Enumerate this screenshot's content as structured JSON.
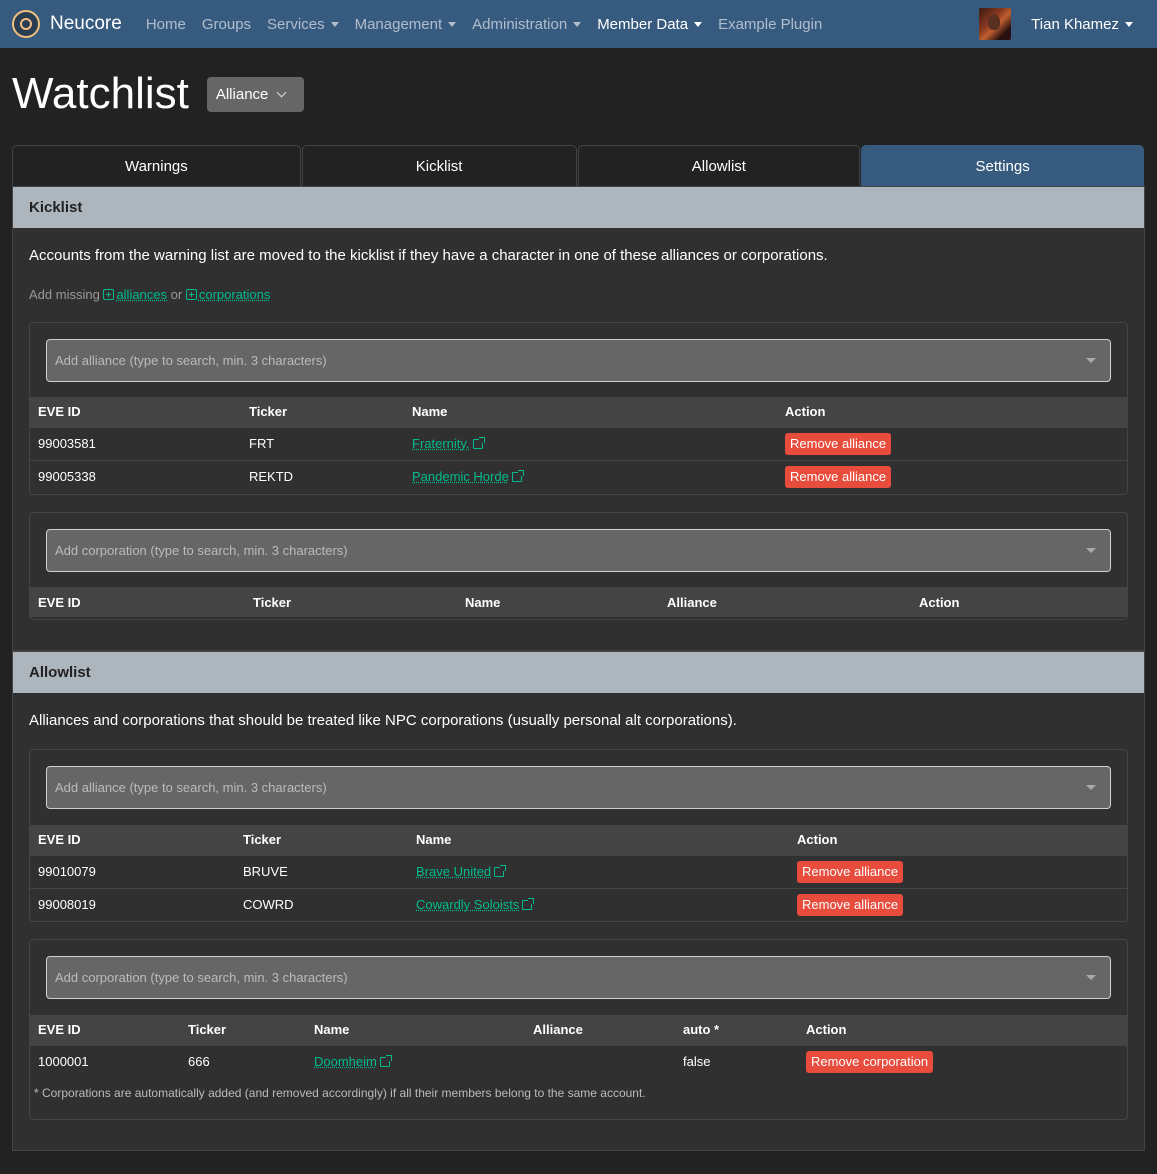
{
  "nav": {
    "brand": "Neucore",
    "items": [
      "Home",
      "Groups",
      "Services",
      "Management",
      "Administration",
      "Member Data",
      "Example Plugin"
    ],
    "user": "Tian Khamez"
  },
  "header": {
    "title": "Watchlist",
    "select_value": "Alliance"
  },
  "tabs": [
    "Warnings",
    "Kicklist",
    "Allowlist",
    "Settings"
  ],
  "kicklist": {
    "title": "Kicklist",
    "description": "Accounts from the warning list are moved to the kicklist if they have a character in one of these alliances or corporations.",
    "add_missing": "Add missing",
    "alliances_link": "alliances",
    "or": "or",
    "corporations_link": "corporations",
    "alliance_placeholder": "Add alliance (type to search, min. 3 characters)",
    "alliance_headers": [
      "EVE ID",
      "Ticker",
      "Name",
      "Action"
    ],
    "alliances": [
      {
        "id": "99003581",
        "ticker": "FRT",
        "name": "Fraternity.",
        "action": "Remove alliance"
      },
      {
        "id": "99005338",
        "ticker": "REKTD",
        "name": "Pandemic Horde",
        "action": "Remove alliance"
      }
    ],
    "corporation_placeholder": "Add corporation (type to search, min. 3 characters)",
    "corporation_headers": [
      "EVE ID",
      "Ticker",
      "Name",
      "Alliance",
      "Action"
    ]
  },
  "allowlist": {
    "title": "Allowlist",
    "description": "Alliances and corporations that should be treated like NPC corporations (usually personal alt corporations).",
    "alliance_placeholder": "Add alliance (type to search, min. 3 characters)",
    "alliance_headers": [
      "EVE ID",
      "Ticker",
      "Name",
      "Action"
    ],
    "alliances": [
      {
        "id": "99010079",
        "ticker": "BRUVE",
        "name": "Brave United",
        "action": "Remove alliance"
      },
      {
        "id": "99008019",
        "ticker": "COWRD",
        "name": "Cowardly Soloists",
        "action": "Remove alliance"
      }
    ],
    "corporation_placeholder": "Add corporation (type to search, min. 3 characters)",
    "corporation_headers": [
      "EVE ID",
      "Ticker",
      "Name",
      "Alliance",
      "auto *",
      "Action"
    ],
    "corporations": [
      {
        "id": "1000001",
        "ticker": "666",
        "name": "Doomheim",
        "alliance": "",
        "auto": "false",
        "action": "Remove corporation"
      }
    ],
    "footnote": "* Corporations are automatically added (and removed accordingly) if all their members belong to the same account."
  },
  "colors": {
    "navbar": "#375a7f",
    "danger": "#e74c3c",
    "link": "#00bc8c",
    "card_header": "#adb5bd"
  }
}
